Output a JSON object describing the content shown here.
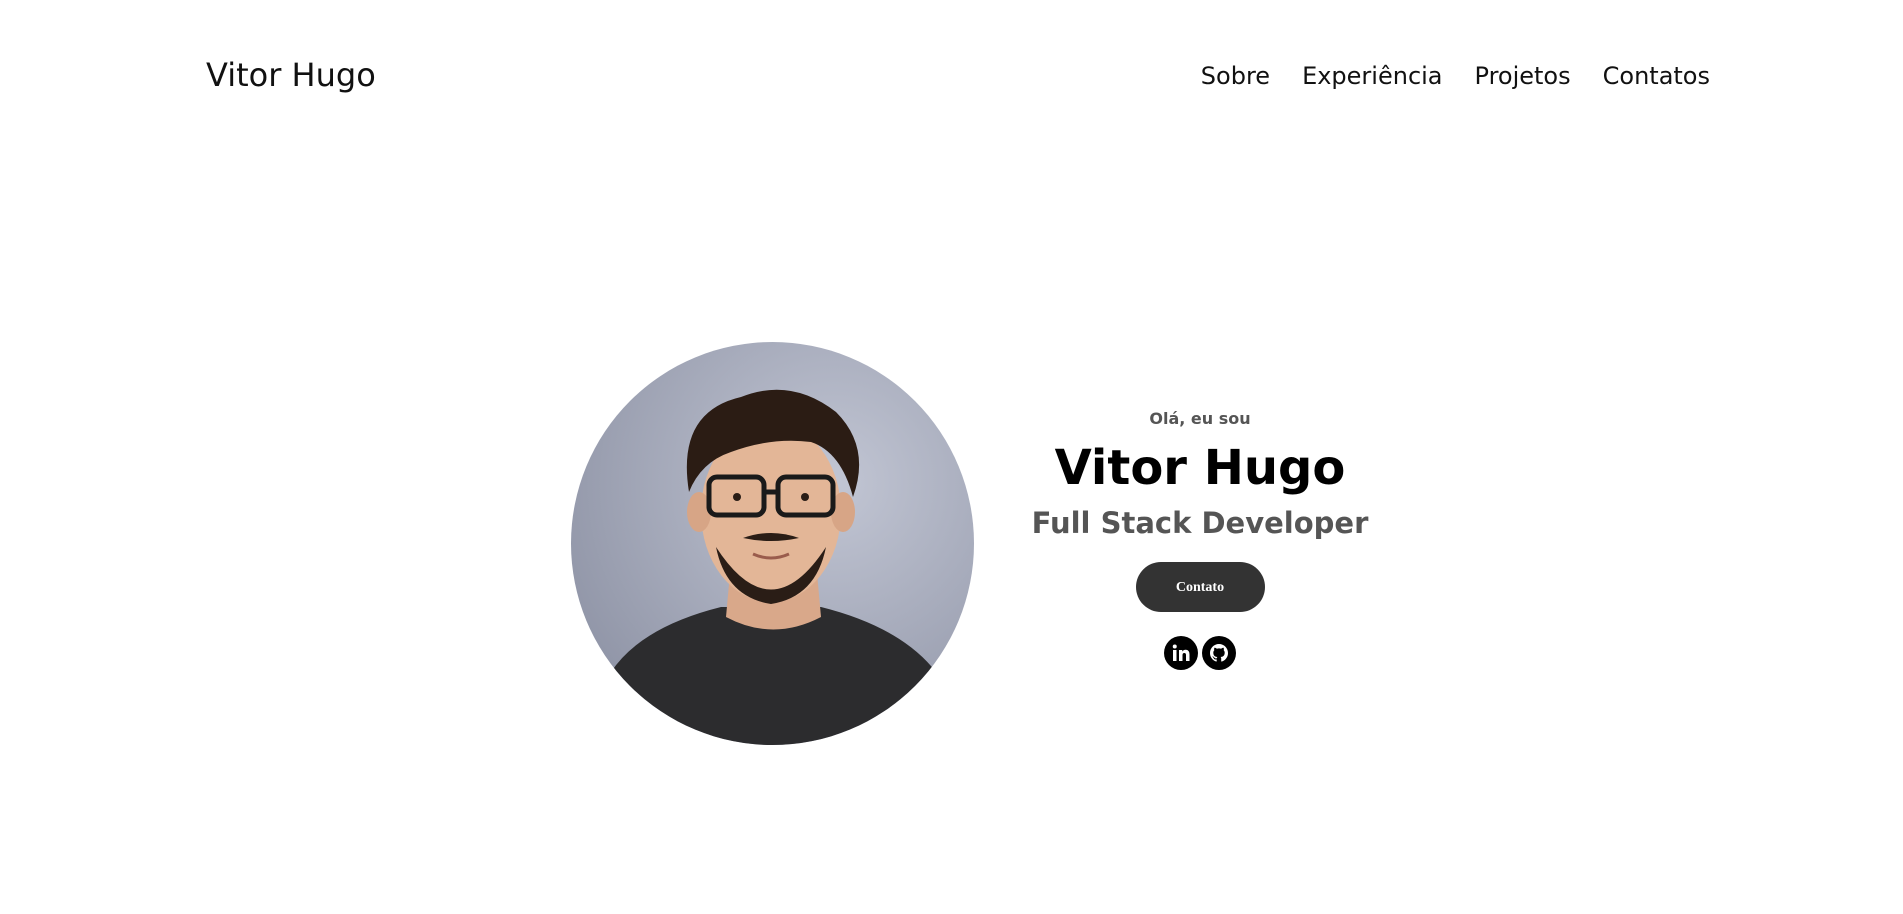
{
  "nav": {
    "logo": "Vitor Hugo",
    "links": [
      {
        "label": "Sobre"
      },
      {
        "label": "Experiência"
      },
      {
        "label": "Projetos"
      },
      {
        "label": "Contatos"
      }
    ]
  },
  "hero": {
    "greeting": "Olá, eu sou",
    "name": "Vitor Hugo",
    "role": "Full Stack Developer",
    "contact_button": "Contato",
    "socials": [
      {
        "icon": "linkedin-icon"
      },
      {
        "icon": "github-icon"
      }
    ]
  },
  "colors": {
    "background": "#ffffff",
    "text": "#111111",
    "muted_text": "#555555",
    "button_bg": "#333333",
    "button_text": "#ffffff"
  }
}
